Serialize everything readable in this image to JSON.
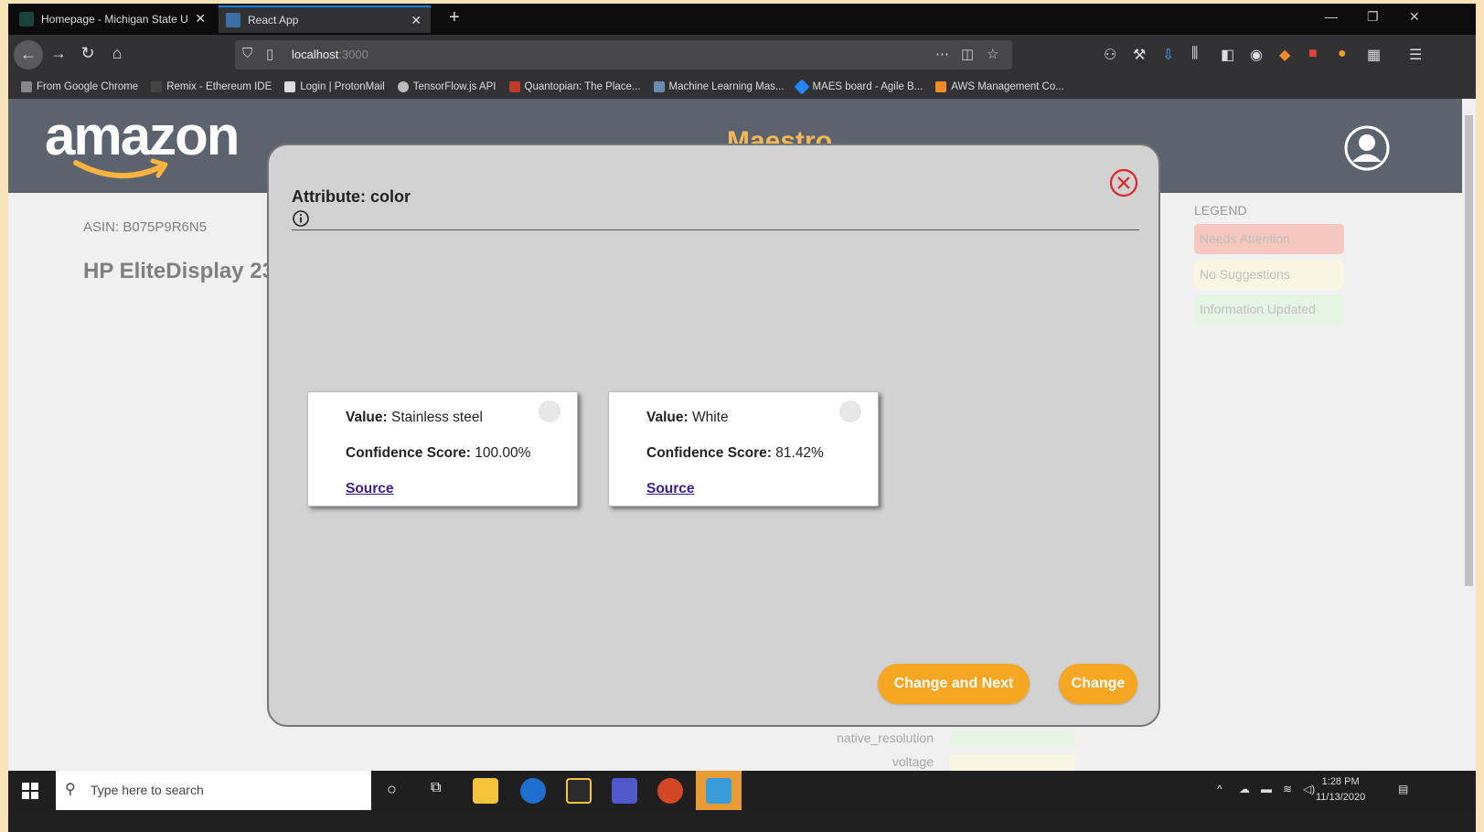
{
  "browser": {
    "tabs": [
      {
        "label": "Homepage - Michigan State U",
        "active": false
      },
      {
        "label": "React App",
        "active": true
      }
    ],
    "url": {
      "host": "localhost",
      "port": ":3000"
    },
    "bookmarks": [
      "From Google Chrome",
      "Remix - Ethereum IDE",
      "Login | ProtonMail",
      "TensorFlow.js API",
      "Quantopian: The Place...",
      "Machine Learning Mas...",
      "MAES board - Agile B...",
      "AWS Management Co..."
    ]
  },
  "app": {
    "logo_text": "amazon",
    "title": "Maestro",
    "asin": "ASIN: B075P9R6N5",
    "product_title": "HP EliteDisplay 23",
    "legend": {
      "title": "LEGEND",
      "items": [
        {
          "label": "Needs Attention",
          "color": "#f2b5a9"
        },
        {
          "label": "No Suggestions",
          "color": "#f6f3da"
        },
        {
          "label": "Information Updated",
          "color": "#dcf2da"
        }
      ]
    },
    "attributes": [
      {
        "name": "native_resolution",
        "color": "#dcf2da"
      },
      {
        "name": "voltage",
        "color": "#f6f3da"
      }
    ]
  },
  "modal": {
    "title": "Attribute: color",
    "cards": [
      {
        "value_label": "Value:",
        "value": "Stainless steel",
        "score_label": "Confidence Score:",
        "score": "100.00%",
        "source": "Source"
      },
      {
        "value_label": "Value:",
        "value": "White",
        "score_label": "Confidence Score:",
        "score": "81.42%",
        "source": "Source"
      }
    ],
    "buttons": {
      "change_next": "Change and Next",
      "change": "Change"
    },
    "accent_color": "#f5a623",
    "close_color": "#e02424"
  },
  "taskbar": {
    "search_placeholder": "Type here to search",
    "time": "1:28 PM",
    "date": "11/13/2020"
  }
}
